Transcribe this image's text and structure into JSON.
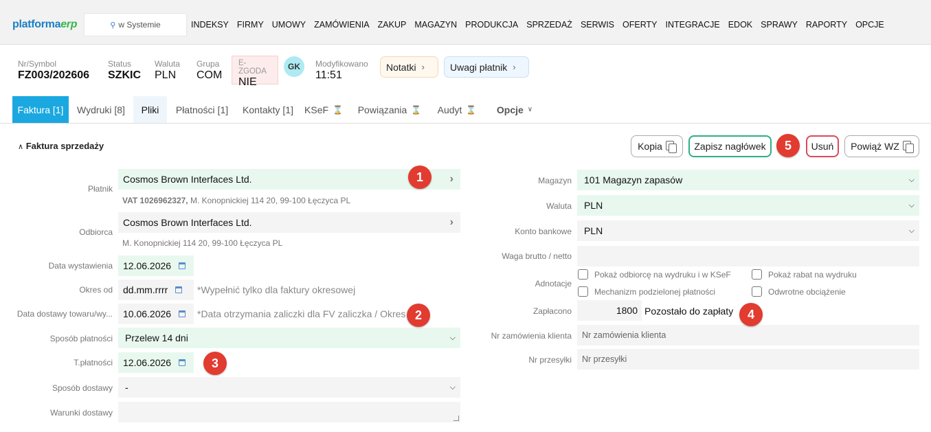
{
  "nav": {
    "logo_a": "platforma",
    "logo_b": "erp",
    "search_placeholder": "w Systemie",
    "menu": [
      "INDEKSY",
      "FIRMY",
      "UMOWY",
      "ZAMÓWIENIA",
      "ZAKUP",
      "MAGAZYN",
      "PRODUKCJA",
      "SPRZEDAŻ",
      "SERWIS",
      "OFERTY",
      "INTEGRACJE",
      "EDOK",
      "SPRAWY",
      "RAPORTY",
      "OPCJE"
    ]
  },
  "header": {
    "symbol_label": "Nr/Symbol",
    "symbol": "FZ003/202606",
    "status_label": "Status",
    "status": "SZKIC",
    "waluta_label": "Waluta",
    "waluta": "PLN",
    "grupa_label": "Grupa",
    "grupa": "COM",
    "ezgoda_label": "E-ZGODA",
    "ezgoda": "NIE",
    "avatar": "GK",
    "modified_label": "Modyfikowano",
    "modified": "11:51",
    "notatki": "Notatki",
    "uwagi": "Uwagi płatnik"
  },
  "tabs": {
    "faktura": "Faktura [1]",
    "wydruki": "Wydruki [8]",
    "pliki": "Pliki",
    "platnosci": "Płatności [1]",
    "kontakty": "Kontakty [1]",
    "ksef": "KSeF",
    "powiazania": "Powiązania",
    "audyt": "Audyt",
    "opcje": "Opcje"
  },
  "section": {
    "title": "Faktura sprzedaży",
    "kopia": "Kopia",
    "zapisz": "Zapisz nagłówek",
    "usun": "Usuń",
    "powiaz": "Powiąż WZ"
  },
  "badges": [
    "1",
    "2",
    "3",
    "4",
    "5"
  ],
  "form_left": {
    "platnik_label": "Płatnik",
    "platnik": "Cosmos Brown Interfaces Ltd.",
    "platnik_vat": "VAT 1026962327,",
    "platnik_addr": " M. Konopnickiej 114 20, 99-100 Łęczyca PL",
    "odbiorca_label": "Odbiorca",
    "odbiorca": "Cosmos Brown Interfaces Ltd.",
    "odbiorca_addr": "M. Konopnickiej 114 20, 99-100 Łęczyca PL",
    "data_wyst_label": "Data wystawienia",
    "data_wyst": "12.06.2026",
    "okres_label": "Okres od",
    "okres": "dd.mm.rrrr",
    "okres_hint": "*Wypełnić tylko dla faktury okresowej",
    "data_dost_label": "Data dostawy towaru/wy...",
    "data_dost": "10.06.2026",
    "data_dost_hint": "*Data otrzymania zaliczki dla FV zaliczka / Okres",
    "sposob_plat_label": "Sposób płatności",
    "sposob_plat": "Przelew 14 dni",
    "tplat_label": "T.płatności",
    "tplat": "12.06.2026",
    "sposob_dost_label": "Sposób dostawy",
    "sposob_dost": "-",
    "warunki_label": "Warunki dostawy",
    "warunki": ""
  },
  "form_right": {
    "magazyn_label": "Magazyn",
    "magazyn": "101 Magazyn zapasów",
    "waluta_label": "Waluta",
    "waluta": "PLN",
    "konto_label": "Konto bankowe",
    "konto": "PLN",
    "waga_label": "Waga brutto / netto",
    "waga": "",
    "adnotacje_label": "Adnotacje",
    "chk1": "Pokaż odbiorcę na wydruku i w KSeF",
    "chk2": "Pokaż rabat na wydruku",
    "chk3": "Mechanizm podzielonej płatności",
    "chk4": "Odwrotne obciążenie",
    "zaplacono_label": "Zapłacono",
    "zaplacono": "1800",
    "pozostalo": "Pozostało do zapłaty",
    "nr_zam_label": "Nr zamówienia klienta",
    "nr_zam_ph": "Nr zamówienia klienta",
    "nr_przes_label": "Nr przesyłki",
    "nr_przes_ph": "Nr przesyłki"
  }
}
